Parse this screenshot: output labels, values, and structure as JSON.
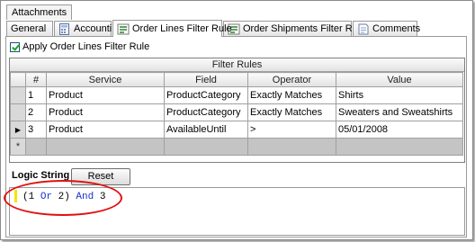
{
  "tabs_top": [
    {
      "label": "Attachments"
    }
  ],
  "tabs": [
    {
      "label": "General"
    },
    {
      "label": "Accounting"
    },
    {
      "label": "Order Lines Filter Rule"
    },
    {
      "label": "Order Shipments Filter Rule"
    },
    {
      "label": "Comments"
    }
  ],
  "apply_checkbox": {
    "label": "Apply Order Lines Filter Rule",
    "checked": true
  },
  "grid": {
    "title": "Filter Rules",
    "columns": [
      "#",
      "Service",
      "Field",
      "Operator",
      "Value"
    ],
    "rows": [
      {
        "num": "1",
        "service": "Product",
        "field": "ProductCategory",
        "operator": "Exactly Matches",
        "value": "Shirts"
      },
      {
        "num": "2",
        "service": "Product",
        "field": "ProductCategory",
        "operator": "Exactly Matches",
        "value": "Sweaters and Sweatshirts"
      },
      {
        "num": "3",
        "service": "Product",
        "field": "AvailableUntil",
        "operator": ">",
        "value": "05/01/2008"
      }
    ],
    "current_row_marker": "▶",
    "new_row_marker": "*"
  },
  "logic": {
    "label": "Logic String",
    "reset_label": "Reset",
    "tokens": [
      {
        "text": "(1 ",
        "keyword": false
      },
      {
        "text": "Or",
        "keyword": true
      },
      {
        "text": " 2) ",
        "keyword": false
      },
      {
        "text": "And",
        "keyword": true
      },
      {
        "text": " 3",
        "keyword": false
      }
    ]
  },
  "colors": {
    "annotation": "#e01010",
    "keyword": "#1a2fcc",
    "check": "#21a121"
  }
}
